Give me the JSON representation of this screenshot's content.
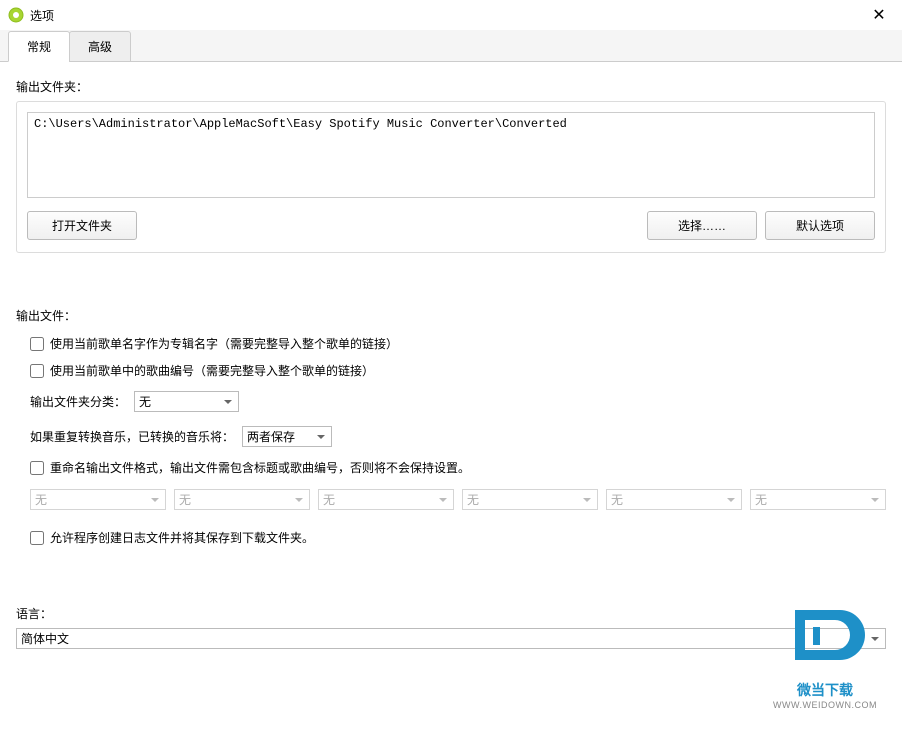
{
  "window": {
    "title": "选项",
    "close_glyph": "✕"
  },
  "tabs": {
    "general": "常规",
    "advanced": "高级"
  },
  "output_folder": {
    "label": "输出文件夹：",
    "path": "C:\\Users\\Administrator\\AppleMacSoft\\Easy Spotify Music Converter\\Converted",
    "open_btn": "打开文件夹",
    "select_btn": "选择……",
    "default_btn": "默认选项"
  },
  "output_file": {
    "label": "输出文件：",
    "cb_album_name": "使用当前歌单名字作为专辑名字（需要完整导入整个歌单的链接）",
    "cb_track_number": "使用当前歌单中的歌曲编号（需要完整导入整个歌单的链接）",
    "folder_sort_label": "输出文件夹分类：",
    "folder_sort_value": "无",
    "repeat_label": "如果重复转换音乐，已转换的音乐将：",
    "repeat_value": "两者保存",
    "cb_rename": "重命名输出文件格式，输出文件需包含标题或歌曲编号，否则将不会保持设置。",
    "rename_none": "无",
    "cb_log": "允许程序创建日志文件并将其保存到下载文件夹。"
  },
  "language": {
    "label": "语言：",
    "value": "简体中文"
  },
  "branding": {
    "text": "微当下载",
    "url": "WWW.WEIDOWN.COM"
  }
}
